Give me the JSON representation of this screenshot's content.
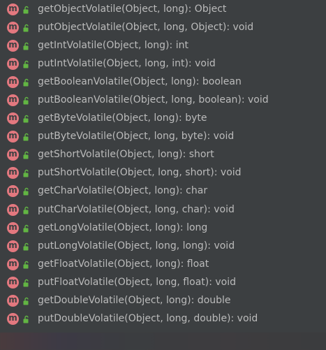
{
  "members": [
    {
      "label": "getObjectVolatile(Object, long): Object",
      "icon": "method-icon",
      "modifier_icon": "public-lock-icon"
    },
    {
      "label": "putObjectVolatile(Object, long, Object): void",
      "icon": "method-icon",
      "modifier_icon": "public-lock-icon"
    },
    {
      "label": "getIntVolatile(Object, long): int",
      "icon": "method-icon",
      "modifier_icon": "public-lock-icon"
    },
    {
      "label": "putIntVolatile(Object, long, int): void",
      "icon": "method-icon",
      "modifier_icon": "public-lock-icon"
    },
    {
      "label": "getBooleanVolatile(Object, long): boolean",
      "icon": "method-icon",
      "modifier_icon": "public-lock-icon"
    },
    {
      "label": "putBooleanVolatile(Object, long, boolean): void",
      "icon": "method-icon",
      "modifier_icon": "public-lock-icon"
    },
    {
      "label": "getByteVolatile(Object, long): byte",
      "icon": "method-icon",
      "modifier_icon": "public-lock-icon"
    },
    {
      "label": "putByteVolatile(Object, long, byte): void",
      "icon": "method-icon",
      "modifier_icon": "public-lock-icon"
    },
    {
      "label": "getShortVolatile(Object, long): short",
      "icon": "method-icon",
      "modifier_icon": "public-lock-icon"
    },
    {
      "label": "putShortVolatile(Object, long, short): void",
      "icon": "method-icon",
      "modifier_icon": "public-lock-icon"
    },
    {
      "label": "getCharVolatile(Object, long): char",
      "icon": "method-icon",
      "modifier_icon": "public-lock-icon"
    },
    {
      "label": "putCharVolatile(Object, long, char): void",
      "icon": "method-icon",
      "modifier_icon": "public-lock-icon"
    },
    {
      "label": "getLongVolatile(Object, long): long",
      "icon": "method-icon",
      "modifier_icon": "public-lock-icon"
    },
    {
      "label": "putLongVolatile(Object, long, long): void",
      "icon": "method-icon",
      "modifier_icon": "public-lock-icon"
    },
    {
      "label": "getFloatVolatile(Object, long): float",
      "icon": "method-icon",
      "modifier_icon": "public-lock-icon"
    },
    {
      "label": "putFloatVolatile(Object, long, float): void",
      "icon": "method-icon",
      "modifier_icon": "public-lock-icon"
    },
    {
      "label": "getDoubleVolatile(Object, long): double",
      "icon": "method-icon",
      "modifier_icon": "public-lock-icon"
    },
    {
      "label": "putDoubleVolatile(Object, long, double): void",
      "icon": "method-icon",
      "modifier_icon": "public-lock-icon"
    }
  ],
  "colors": {
    "background": "#3c3f41",
    "text": "#bbbbbb",
    "method_icon": "#e3787f",
    "lock_icon": "#62b543"
  }
}
